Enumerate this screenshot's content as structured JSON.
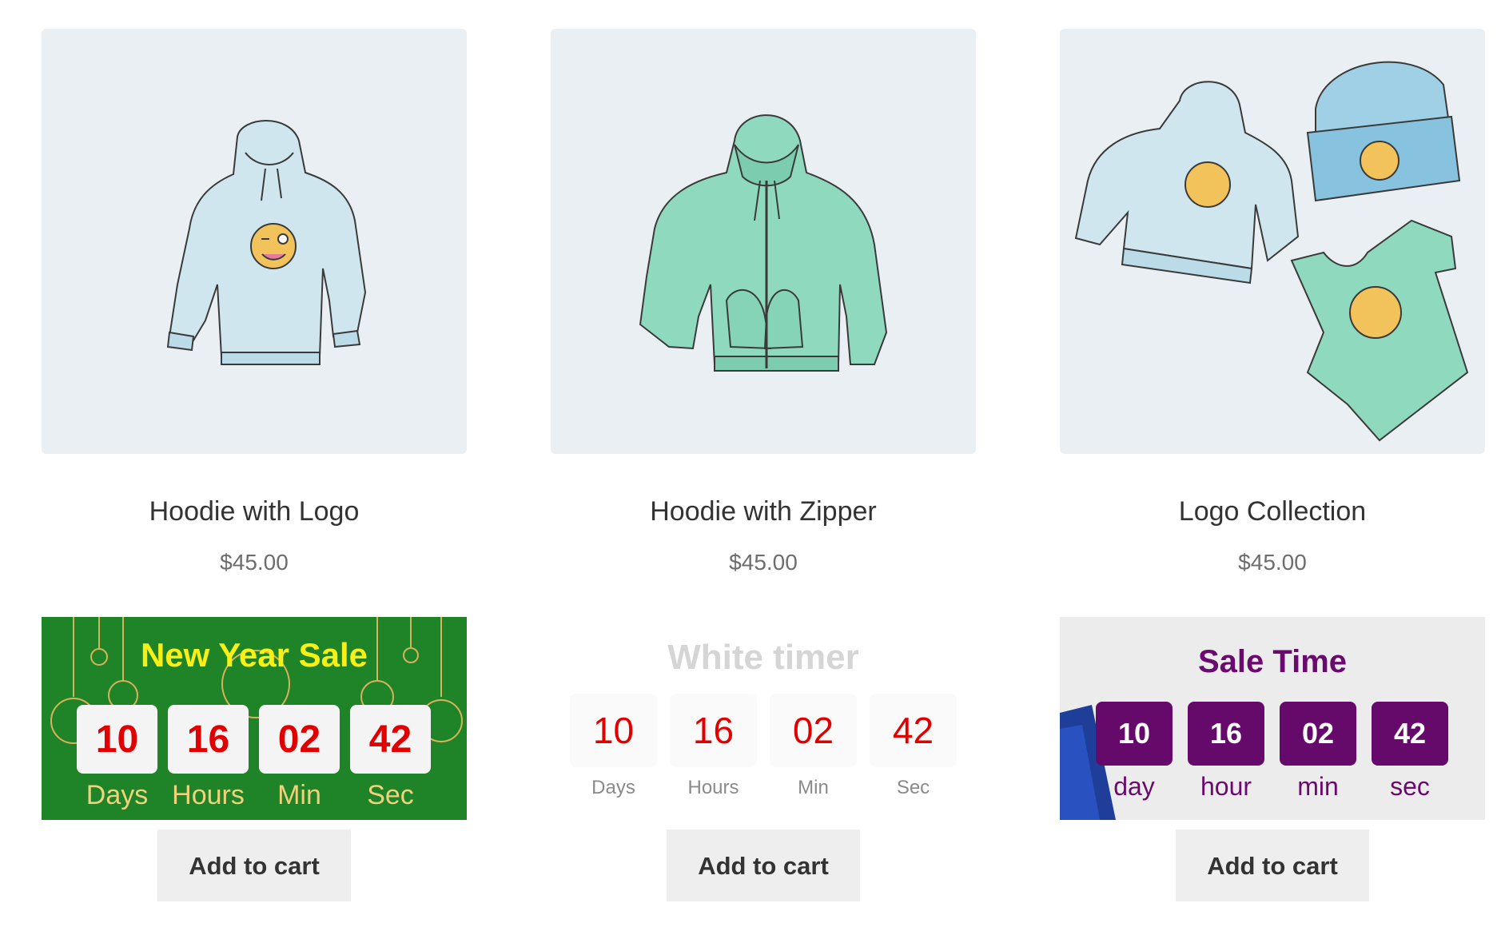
{
  "products": [
    {
      "title": "Hoodie with Logo",
      "price": "$45.00",
      "image_icon": "hoodie-logo-image",
      "timer": {
        "heading": "New Year Sale",
        "values": [
          "10",
          "16",
          "02",
          "42"
        ],
        "labels": [
          "Days",
          "Hours",
          "Min",
          "Sec"
        ]
      },
      "button": "Add to cart"
    },
    {
      "title": "Hoodie with Zipper",
      "price": "$45.00",
      "image_icon": "hoodie-zipper-image",
      "timer": {
        "heading": "White timer",
        "values": [
          "10",
          "16",
          "02",
          "42"
        ],
        "labels": [
          "Days",
          "Hours",
          "Min",
          "Sec"
        ]
      },
      "button": "Add to cart"
    },
    {
      "title": "Logo Collection",
      "price": "$45.00",
      "image_icon": "logo-collection-image",
      "timer": {
        "heading": "Sale Time",
        "values": [
          "10",
          "16",
          "02",
          "42"
        ],
        "labels": [
          "day",
          "hour",
          "min",
          "sec"
        ]
      },
      "button": "Add to cart"
    }
  ],
  "colors": {
    "timer1_bg": "#1e8427",
    "timer1_heading": "#f7ef16",
    "timer_digits_red": "#e10000",
    "timer3_cell": "#650a6b",
    "thumb_bg": "#e9eff3"
  }
}
